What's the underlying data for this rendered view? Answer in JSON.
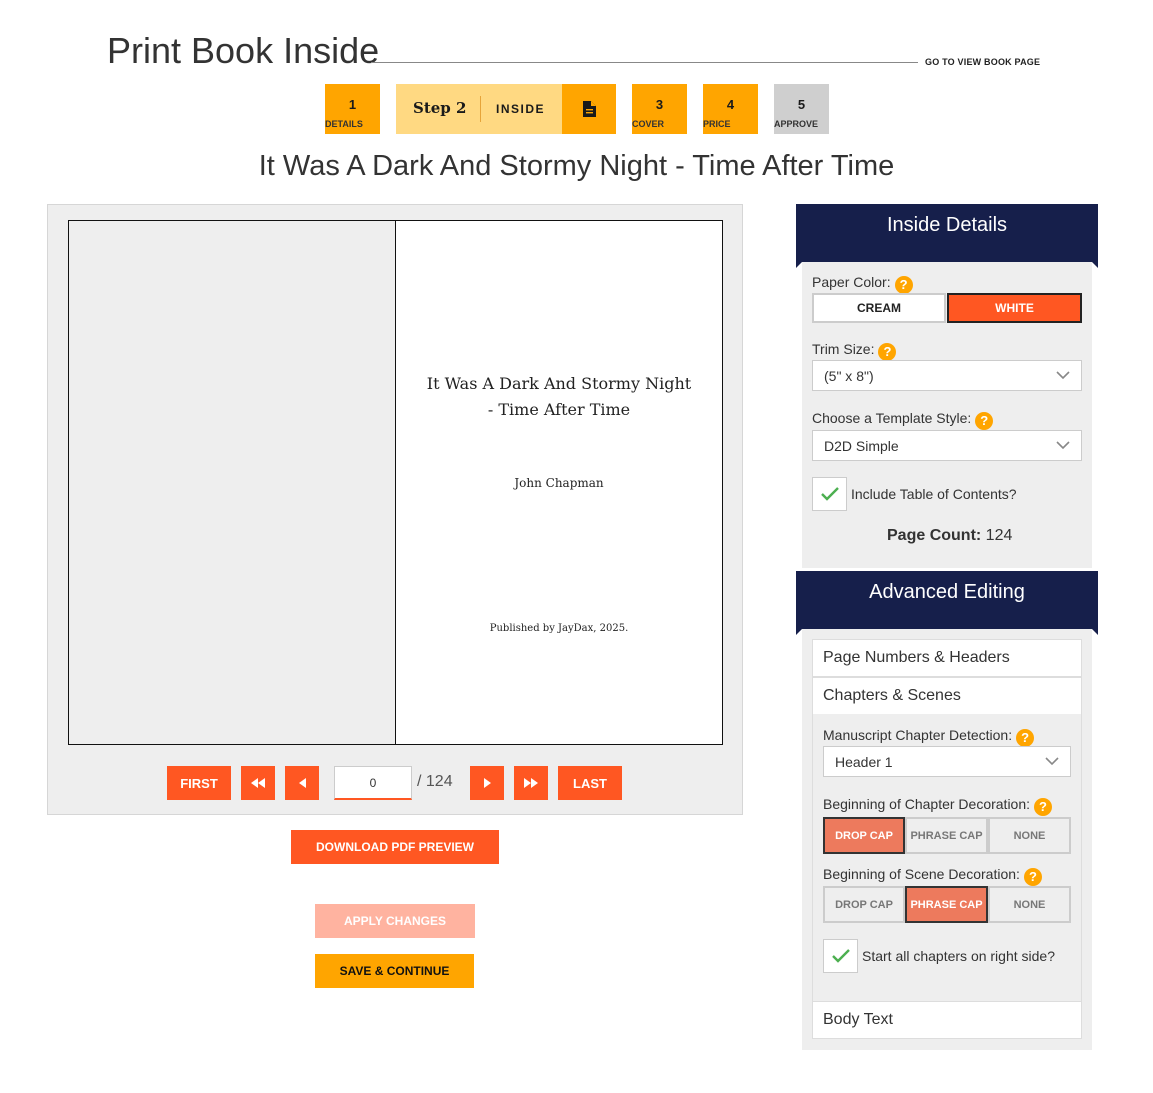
{
  "header": {
    "title": "Print Book Inside",
    "goto_link": "GO TO VIEW BOOK PAGE"
  },
  "steps": [
    {
      "num": "1",
      "label": "DETAILS"
    },
    {
      "num": "Step 2",
      "label": "INSIDE"
    },
    {
      "num": "3",
      "label": "COVER"
    },
    {
      "num": "4",
      "label": "PRICE"
    },
    {
      "num": "5",
      "label": "APPROVE"
    }
  ],
  "book_title": "It Was A Dark And Stormy Night - Time After Time",
  "preview": {
    "page_title_line1": "It Was A Dark And Stormy Night",
    "page_title_line2": "- Time After Time",
    "author": "John Chapman",
    "publisher": "Published by JayDax, 2025.",
    "nav": {
      "first": "FIRST",
      "last": "LAST",
      "current_page": "0",
      "total": "/ 124"
    }
  },
  "actions": {
    "download": "DOWNLOAD PDF PREVIEW",
    "apply": "APPLY CHANGES",
    "save": "SAVE & CONTINUE"
  },
  "inside_details": {
    "heading": "Inside Details",
    "paper_color_label": "Paper Color:",
    "paper_options": [
      "CREAM",
      "WHITE"
    ],
    "paper_selected": "WHITE",
    "trim_label": "Trim Size:",
    "trim_value": "(5\" x 8\")",
    "template_label": "Choose a Template Style:",
    "template_value": "D2D Simple",
    "toc_label": "Include Table of Contents?",
    "toc_checked": true,
    "page_count_label": "Page Count:",
    "page_count": "124"
  },
  "advanced": {
    "heading": "Advanced Editing",
    "sections": [
      "Page Numbers & Headers",
      "Chapters & Scenes",
      "Body Text"
    ],
    "detection_label": "Manuscript Chapter Detection:",
    "detection_value": "Header 1",
    "chapter_deco_label": "Beginning of Chapter Decoration:",
    "chapter_options": [
      "DROP CAP",
      "PHRASE CAP",
      "NONE"
    ],
    "chapter_selected": "DROP CAP",
    "scene_deco_label": "Beginning of Scene Decoration:",
    "scene_options": [
      "DROP CAP",
      "PHRASE CAP",
      "NONE"
    ],
    "scene_selected": "PHRASE CAP",
    "right_side_label": "Start all chapters on right side?",
    "right_side_checked": true
  },
  "colors": {
    "orange": "#ffa500",
    "accent": "#ff5722",
    "navy": "#161f4b"
  }
}
